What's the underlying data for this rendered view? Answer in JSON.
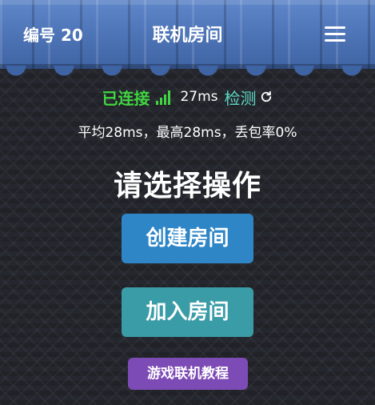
{
  "header": {
    "room_no": "编号 20",
    "title": "联机房间",
    "menu_icon": "hamburger-menu-icon"
  },
  "connection": {
    "status": "已连接",
    "status_color": "#41d641",
    "signal_icon": "signal-strength-icon",
    "ping": "27ms",
    "check_label": "检测",
    "check_icon": "refresh-icon",
    "stats": "平均28ms，最高28ms，丢包率0%"
  },
  "main": {
    "prompt": "请选择操作",
    "create_label": "创建房间",
    "join_label": "加入房间",
    "tutorial_label": "游戏联机教程"
  },
  "colors": {
    "header": "#4f76b8",
    "create_button": "#2f86c7",
    "join_button": "#3a9ca6",
    "tutorial_button": "#7d4bb5",
    "check_link": "#5dd8c4"
  }
}
